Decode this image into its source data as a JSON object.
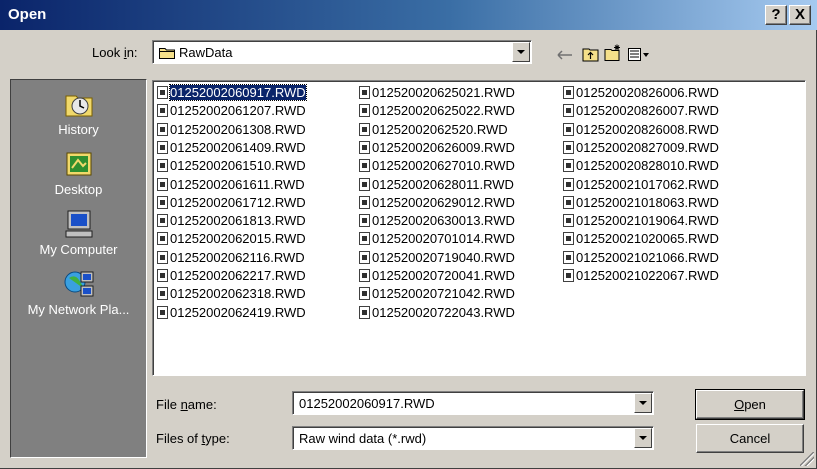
{
  "window": {
    "title": "Open",
    "help_label": "?",
    "close_label": "X"
  },
  "look_in": {
    "label_pre": "Look ",
    "label_accel": "i",
    "label_post": "n:",
    "value": "RawData"
  },
  "toolbar": {
    "icons": [
      "back-arrow-icon",
      "up-folder-icon",
      "new-folder-icon",
      "view-menu-icon"
    ]
  },
  "places": [
    {
      "label": "History",
      "icon": "history-icon"
    },
    {
      "label": "Desktop",
      "icon": "desktop-icon"
    },
    {
      "label": "My Computer",
      "icon": "my-computer-icon"
    },
    {
      "label": "My Network Pla...",
      "icon": "network-places-icon"
    }
  ],
  "files": {
    "columns": [
      [
        "01252002060917.RWD",
        "01252002061207.RWD",
        "01252002061308.RWD",
        "01252002061409.RWD",
        "01252002061510.RWD",
        "01252002061611.RWD",
        "01252002061712.RWD",
        "01252002061813.RWD",
        "01252002062015.RWD",
        "01252002062116.RWD",
        "01252002062217.RWD",
        "01252002062318.RWD",
        "01252002062419.RWD"
      ],
      [
        "012520020625021.RWD",
        "012520020625022.RWD",
        "01252002062520.RWD",
        "012520020626009.RWD",
        "012520020627010.RWD",
        "012520020628011.RWD",
        "012520020629012.RWD",
        "012520020630013.RWD",
        "012520020701014.RWD",
        "012520020719040.RWD",
        "012520020720041.RWD",
        "012520020721042.RWD",
        "012520020722043.RWD"
      ],
      [
        "012520020826006.RWD",
        "012520020826007.RWD",
        "012520020826008.RWD",
        "012520020827009.RWD",
        "012520020828010.RWD",
        "012520021017062.RWD",
        "012520021018063.RWD",
        "012520021019064.RWD",
        "012520021020065.RWD",
        "012520021021066.RWD",
        "012520021022067.RWD"
      ]
    ],
    "selected": "01252002060917.RWD"
  },
  "file_name": {
    "label_pre": "File ",
    "label_accel": "n",
    "label_post": "ame:",
    "value": "01252002060917.RWD"
  },
  "file_type": {
    "label_pre": "Files of ",
    "label_accel": "t",
    "label_post": "ype:",
    "value": "Raw wind data (*.rwd)"
  },
  "buttons": {
    "open_accel": "O",
    "open_rest": "pen",
    "cancel": "Cancel"
  },
  "colors": {
    "title_start": "#0a246a",
    "title_end": "#a6caf0",
    "face": "#d4d0c8",
    "places_bg": "#808080",
    "selection": "#0a246a"
  }
}
